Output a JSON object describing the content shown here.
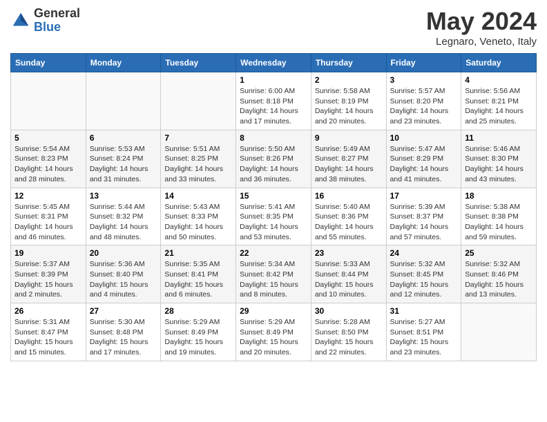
{
  "logo": {
    "general": "General",
    "blue": "Blue"
  },
  "header": {
    "month_year": "May 2024",
    "location": "Legnaro, Veneto, Italy"
  },
  "days_of_week": [
    "Sunday",
    "Monday",
    "Tuesday",
    "Wednesday",
    "Thursday",
    "Friday",
    "Saturday"
  ],
  "weeks": [
    [
      {
        "day": "",
        "info": ""
      },
      {
        "day": "",
        "info": ""
      },
      {
        "day": "",
        "info": ""
      },
      {
        "day": "1",
        "info": "Sunrise: 6:00 AM\nSunset: 8:18 PM\nDaylight: 14 hours and 17 minutes."
      },
      {
        "day": "2",
        "info": "Sunrise: 5:58 AM\nSunset: 8:19 PM\nDaylight: 14 hours and 20 minutes."
      },
      {
        "day": "3",
        "info": "Sunrise: 5:57 AM\nSunset: 8:20 PM\nDaylight: 14 hours and 23 minutes."
      },
      {
        "day": "4",
        "info": "Sunrise: 5:56 AM\nSunset: 8:21 PM\nDaylight: 14 hours and 25 minutes."
      }
    ],
    [
      {
        "day": "5",
        "info": "Sunrise: 5:54 AM\nSunset: 8:23 PM\nDaylight: 14 hours and 28 minutes."
      },
      {
        "day": "6",
        "info": "Sunrise: 5:53 AM\nSunset: 8:24 PM\nDaylight: 14 hours and 31 minutes."
      },
      {
        "day": "7",
        "info": "Sunrise: 5:51 AM\nSunset: 8:25 PM\nDaylight: 14 hours and 33 minutes."
      },
      {
        "day": "8",
        "info": "Sunrise: 5:50 AM\nSunset: 8:26 PM\nDaylight: 14 hours and 36 minutes."
      },
      {
        "day": "9",
        "info": "Sunrise: 5:49 AM\nSunset: 8:27 PM\nDaylight: 14 hours and 38 minutes."
      },
      {
        "day": "10",
        "info": "Sunrise: 5:47 AM\nSunset: 8:29 PM\nDaylight: 14 hours and 41 minutes."
      },
      {
        "day": "11",
        "info": "Sunrise: 5:46 AM\nSunset: 8:30 PM\nDaylight: 14 hours and 43 minutes."
      }
    ],
    [
      {
        "day": "12",
        "info": "Sunrise: 5:45 AM\nSunset: 8:31 PM\nDaylight: 14 hours and 46 minutes."
      },
      {
        "day": "13",
        "info": "Sunrise: 5:44 AM\nSunset: 8:32 PM\nDaylight: 14 hours and 48 minutes."
      },
      {
        "day": "14",
        "info": "Sunrise: 5:43 AM\nSunset: 8:33 PM\nDaylight: 14 hours and 50 minutes."
      },
      {
        "day": "15",
        "info": "Sunrise: 5:41 AM\nSunset: 8:35 PM\nDaylight: 14 hours and 53 minutes."
      },
      {
        "day": "16",
        "info": "Sunrise: 5:40 AM\nSunset: 8:36 PM\nDaylight: 14 hours and 55 minutes."
      },
      {
        "day": "17",
        "info": "Sunrise: 5:39 AM\nSunset: 8:37 PM\nDaylight: 14 hours and 57 minutes."
      },
      {
        "day": "18",
        "info": "Sunrise: 5:38 AM\nSunset: 8:38 PM\nDaylight: 14 hours and 59 minutes."
      }
    ],
    [
      {
        "day": "19",
        "info": "Sunrise: 5:37 AM\nSunset: 8:39 PM\nDaylight: 15 hours and 2 minutes."
      },
      {
        "day": "20",
        "info": "Sunrise: 5:36 AM\nSunset: 8:40 PM\nDaylight: 15 hours and 4 minutes."
      },
      {
        "day": "21",
        "info": "Sunrise: 5:35 AM\nSunset: 8:41 PM\nDaylight: 15 hours and 6 minutes."
      },
      {
        "day": "22",
        "info": "Sunrise: 5:34 AM\nSunset: 8:42 PM\nDaylight: 15 hours and 8 minutes."
      },
      {
        "day": "23",
        "info": "Sunrise: 5:33 AM\nSunset: 8:44 PM\nDaylight: 15 hours and 10 minutes."
      },
      {
        "day": "24",
        "info": "Sunrise: 5:32 AM\nSunset: 8:45 PM\nDaylight: 15 hours and 12 minutes."
      },
      {
        "day": "25",
        "info": "Sunrise: 5:32 AM\nSunset: 8:46 PM\nDaylight: 15 hours and 13 minutes."
      }
    ],
    [
      {
        "day": "26",
        "info": "Sunrise: 5:31 AM\nSunset: 8:47 PM\nDaylight: 15 hours and 15 minutes."
      },
      {
        "day": "27",
        "info": "Sunrise: 5:30 AM\nSunset: 8:48 PM\nDaylight: 15 hours and 17 minutes."
      },
      {
        "day": "28",
        "info": "Sunrise: 5:29 AM\nSunset: 8:49 PM\nDaylight: 15 hours and 19 minutes."
      },
      {
        "day": "29",
        "info": "Sunrise: 5:29 AM\nSunset: 8:49 PM\nDaylight: 15 hours and 20 minutes."
      },
      {
        "day": "30",
        "info": "Sunrise: 5:28 AM\nSunset: 8:50 PM\nDaylight: 15 hours and 22 minutes."
      },
      {
        "day": "31",
        "info": "Sunrise: 5:27 AM\nSunset: 8:51 PM\nDaylight: 15 hours and 23 minutes."
      },
      {
        "day": "",
        "info": ""
      }
    ]
  ]
}
